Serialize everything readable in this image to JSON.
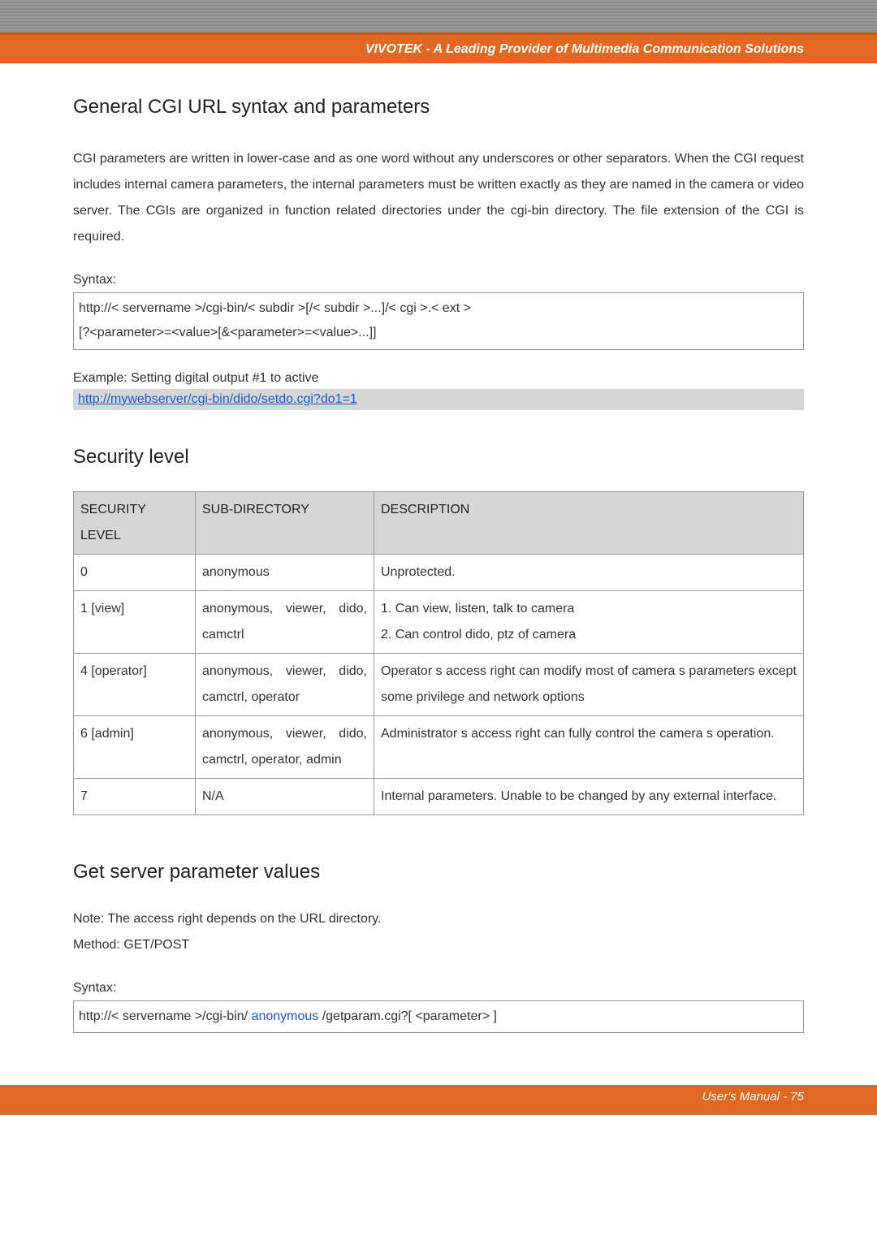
{
  "header": {
    "brand": "VIVOTEK - A Leading Provider of Multimedia Communication Solutions"
  },
  "section1": {
    "title": "General CGI URL syntax and parameters",
    "body": "CGI parameters are written in lower-case and as one word without any underscores or other separators. When the CGI request includes internal camera parameters, the internal parameters must be written exactly as they are named in the camera or video server. The CGIs are organized in function related directories under the cgi-bin directory. The file extension of the CGI is required.",
    "syntax_label": "Syntax:",
    "syntax_code_l1": "http://<   servername  >/cgi-bin/<    subdir >[/<   subdir >...]/<   cgi >.<  ext >",
    "syntax_code_l2": "[?<parameter>=<value>[&<parameter>=<value>...]]",
    "example_label": "Example:    Setting digital output       #1 to active",
    "example_link": "http://mywebserver/cgi-bin/dido/setdo.cgi?do1=1"
  },
  "section2": {
    "title": "Security level",
    "headers": {
      "a": "SECURITY LEVEL",
      "b": "SUB-DIRECTORY",
      "c": "DESCRIPTION"
    },
    "rows": [
      {
        "a": "0",
        "b": "anonymous",
        "c": "Unprotected."
      },
      {
        "a": "1 [view]",
        "b": "anonymous, viewer, dido, camctrl",
        "c": "1. Can view, listen, talk to camera\n2. Can control dido, ptz of camera"
      },
      {
        "a": "4 [operator]",
        "b": "anonymous, viewer, dido, camctrl, operator",
        "c": "Operator s access right can modify most of camera s parameters except some privilege and network options"
      },
      {
        "a": "6 [admin]",
        "b": "anonymous, viewer, dido, camctrl, operator, admin",
        "c": "Administrator s access right can fully control the camera s operation."
      },
      {
        "a": "7",
        "b": "N/A",
        "c": "Internal parameters. Unable to be changed by any external interface."
      }
    ]
  },
  "section3": {
    "title": "Get server parameter values",
    "note1": "Note:   The access right depends on the URL directory.",
    "note2": "Method:    GET/POST",
    "syntax_label": "Syntax:",
    "syntax_pre": "http://<   servername  >/cgi-bin/  ",
    "syntax_anon": "anonymous",
    "syntax_mid": " /getparam.cgi?[    ",
    "syntax_param": "<parameter>",
    "syntax_end": "    ]"
  },
  "footer": {
    "text": "User's Manual - 75"
  }
}
